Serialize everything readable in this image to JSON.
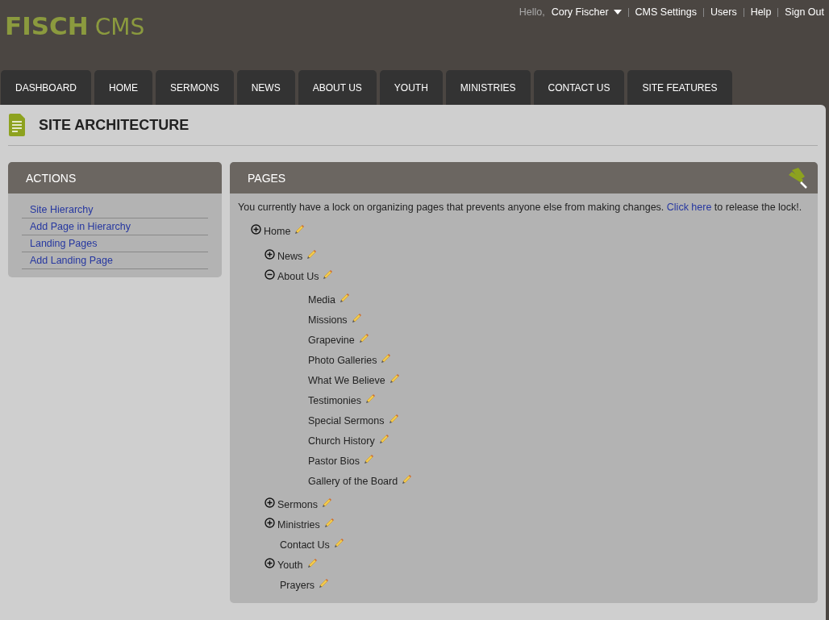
{
  "logo": {
    "bold": "FISCH",
    "light": "CMS"
  },
  "user_menu": {
    "greeting": "Hello,",
    "user": "Cory Fischer",
    "links": [
      "CMS Settings",
      "Users",
      "Help",
      "Sign Out"
    ]
  },
  "tabs": [
    "DASHBOARD",
    "HOME",
    "SERMONS",
    "NEWS",
    "ABOUT US",
    "YOUTH",
    "MINISTRIES",
    "CONTACT US",
    "SITE FEATURES"
  ],
  "page_title": "SITE ARCHITECTURE",
  "actions": {
    "title": "ACTIONS",
    "items": [
      "Site Hierarchy",
      "Add Page in Hierarchy",
      "Landing Pages",
      "Add Landing Page"
    ]
  },
  "pages": {
    "title": "PAGES",
    "notice": {
      "before": "You currently have a lock on organizing pages that prevents anyone else from making changes. ",
      "link": "Click here",
      "after": " to release the lock!."
    },
    "tree": [
      {
        "label": "Home",
        "expanded": false,
        "children": [
          {
            "label": "News",
            "expanded": false
          },
          {
            "label": "About Us",
            "expanded": true,
            "children": [
              {
                "label": "Media"
              },
              {
                "label": "Missions"
              },
              {
                "label": "Grapevine"
              },
              {
                "label": "Photo Galleries"
              },
              {
                "label": "What We Believe"
              },
              {
                "label": "Testimonies"
              },
              {
                "label": "Special Sermons"
              },
              {
                "label": "Church History"
              },
              {
                "label": "Pastor Bios"
              },
              {
                "label": "Gallery of the Board"
              }
            ]
          },
          {
            "label": "Sermons",
            "expanded": false
          },
          {
            "label": "Ministries",
            "expanded": false
          },
          {
            "label": "Contact Us"
          },
          {
            "label": "Youth",
            "expanded": false
          },
          {
            "label": "Prayers"
          }
        ]
      }
    ]
  }
}
